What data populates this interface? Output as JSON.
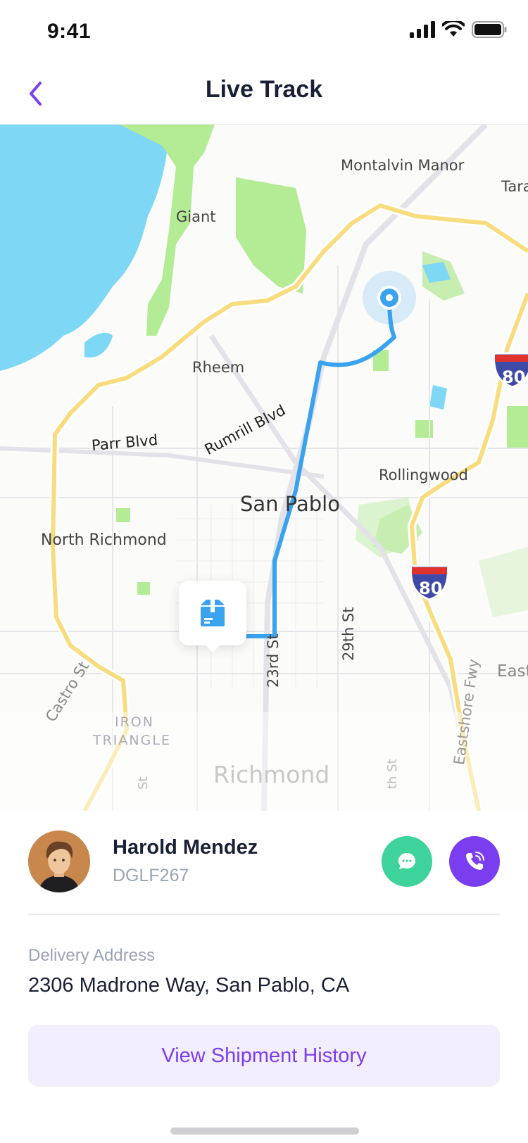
{
  "status_bar": {
    "time": "9:41"
  },
  "header": {
    "title": "Live Track"
  },
  "map": {
    "labels": {
      "montalvin_manor": "Montalvin Manor",
      "tara": "Tara",
      "giant": "Giant",
      "rheem": "Rheem",
      "parr_blvd": "Parr Blvd",
      "rumrill_blvd": "Rumrill Blvd",
      "rollingwood": "Rollingwood",
      "san_pablo": "San Pablo",
      "north_richmond": "North Richmond",
      "st_23rd": "23rd St",
      "st_29th": "29th St",
      "east": "East",
      "castro_st": "Castro St",
      "eastshore_fwy": "Eastshore Fwy",
      "iron": "IRON",
      "triangle": "TRIANGLE",
      "richmond": "Richmond",
      "st_left": "St",
      "th_st_right": "th St"
    },
    "shields": [
      "80",
      "80"
    ],
    "route_color": "#3aa3f0"
  },
  "driver": {
    "name": "Harold Mendez",
    "id": "DGLF267"
  },
  "delivery": {
    "label": "Delivery Address",
    "address": "2306 Madrone Way, San Pablo, CA"
  },
  "actions": {
    "history_label": "View Shipment History"
  },
  "colors": {
    "accent": "#7a3df0",
    "chat": "#3ed39b",
    "title": "#1a2136",
    "muted": "#9aa3b5"
  },
  "icons": {
    "back": "chevron-left-icon",
    "chat": "chat-bubble-icon",
    "call": "phone-call-icon",
    "package": "package-icon",
    "location": "location-pin-icon"
  }
}
